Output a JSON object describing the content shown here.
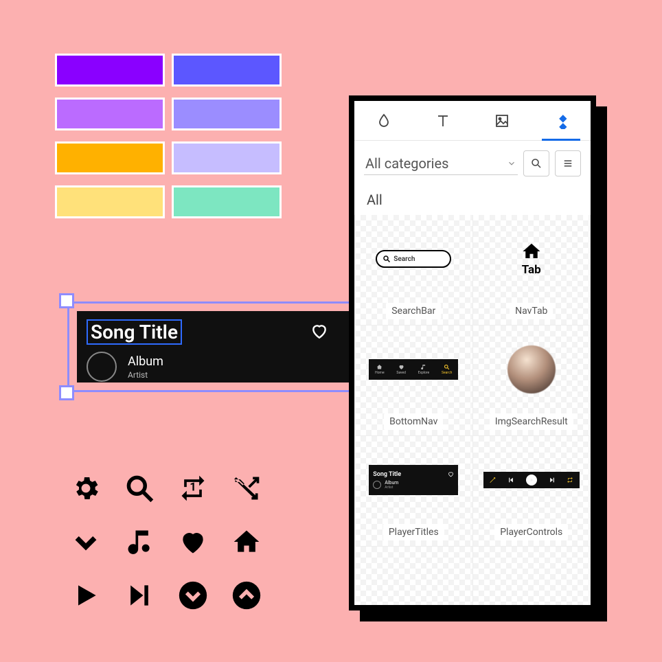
{
  "palette": [
    "#8a00ff",
    "#5c57ff",
    "#bb6bff",
    "#9b8dff",
    "#ffb100",
    "#c6bdff",
    "#ffe17a",
    "#7de6c1"
  ],
  "selected_card": {
    "song_title": "Song Title",
    "album": "Album",
    "artist": "Artist"
  },
  "icon_grid": [
    "gear-icon",
    "search-icon",
    "repeat-one-icon",
    "shuffle-icon",
    "chevron-down-icon",
    "music-note-icon",
    "heart-icon",
    "home-icon",
    "play-icon",
    "skip-next-icon",
    "circle-chevron-down-icon",
    "circle-chevron-up-icon"
  ],
  "panel": {
    "tabs": [
      "water-drop-icon",
      "text-icon",
      "image-icon",
      "sync-icon"
    ],
    "active_tab": 3,
    "category_label": "All categories",
    "section_label": "All",
    "assets": [
      {
        "name": "SearchBar",
        "preview": {
          "type": "searchbar",
          "placeholder": "Search"
        }
      },
      {
        "name": "NavTab",
        "preview": {
          "type": "navtab",
          "label": "Tab"
        }
      },
      {
        "name": "BottomNav",
        "preview": {
          "type": "bottomnav",
          "items": [
            {
              "icon": "home-icon",
              "label": "Home"
            },
            {
              "icon": "heart-icon",
              "label": "Saved"
            },
            {
              "icon": "music-note-icon",
              "label": "Explore"
            },
            {
              "icon": "search-icon",
              "label": "Search",
              "active": true
            }
          ]
        }
      },
      {
        "name": "ImgSearchResult",
        "preview": {
          "type": "avatar"
        }
      },
      {
        "name": "PlayerTitles",
        "preview": {
          "type": "playertitles",
          "title": "Song Title",
          "album": "Album",
          "artist": "Artist"
        }
      },
      {
        "name": "PlayerControls",
        "preview": {
          "type": "playercontrols"
        }
      },
      {
        "name": "",
        "preview": {
          "type": "empty"
        }
      },
      {
        "name": "",
        "preview": {
          "type": "empty"
        }
      }
    ]
  }
}
